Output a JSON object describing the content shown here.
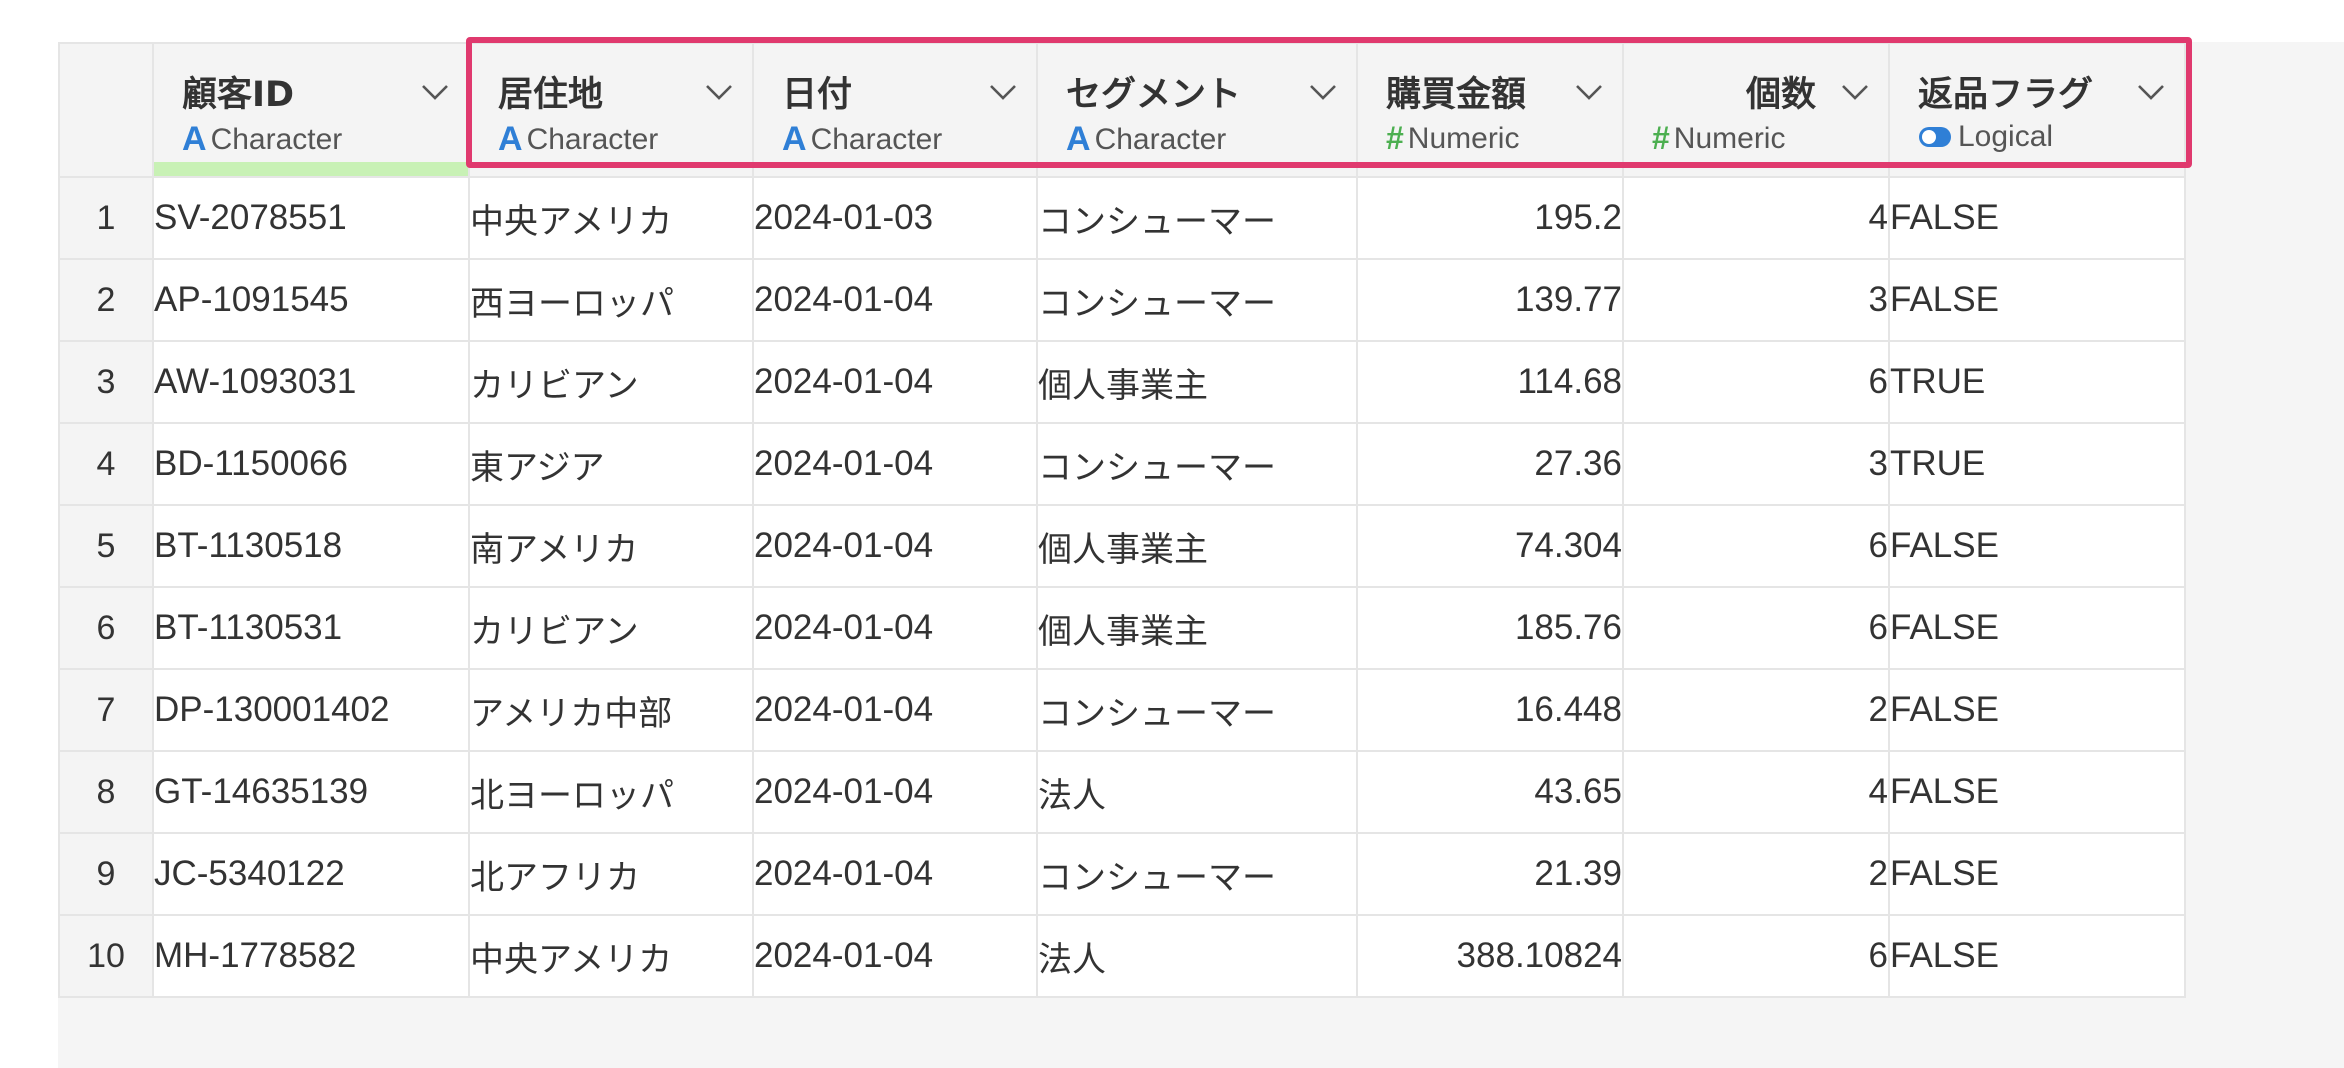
{
  "columns": [
    {
      "name": "顧客ID",
      "type": "Character",
      "type_icon": "character-icon"
    },
    {
      "name": "居住地",
      "type": "Character",
      "type_icon": "character-icon"
    },
    {
      "name": "日付",
      "type": "Character",
      "type_icon": "character-icon"
    },
    {
      "name": "セグメント",
      "type": "Character",
      "type_icon": "character-icon"
    },
    {
      "name": "購買金額",
      "type": "Numeric",
      "type_icon": "numeric-icon"
    },
    {
      "name": "個数",
      "type": "Numeric",
      "type_icon": "numeric-icon"
    },
    {
      "name": "返品フラグ",
      "type": "Logical",
      "type_icon": "logical-toggle-icon"
    }
  ],
  "rows": [
    {
      "n": "1",
      "id": "SV-2078551",
      "loc": "中央アメリカ",
      "date": "2024-01-03",
      "seg": "コンシューマー",
      "amt": "195.2",
      "qty": "4",
      "ret": "FALSE"
    },
    {
      "n": "2",
      "id": "AP-1091545",
      "loc": "西ヨーロッパ",
      "date": "2024-01-04",
      "seg": "コンシューマー",
      "amt": "139.77",
      "qty": "3",
      "ret": "FALSE"
    },
    {
      "n": "3",
      "id": "AW-1093031",
      "loc": "カリビアン",
      "date": "2024-01-04",
      "seg": "個人事業主",
      "amt": "114.68",
      "qty": "6",
      "ret": "TRUE"
    },
    {
      "n": "4",
      "id": "BD-1150066",
      "loc": "東アジア",
      "date": "2024-01-04",
      "seg": "コンシューマー",
      "amt": "27.36",
      "qty": "3",
      "ret": "TRUE"
    },
    {
      "n": "5",
      "id": "BT-1130518",
      "loc": "南アメリカ",
      "date": "2024-01-04",
      "seg": "個人事業主",
      "amt": "74.304",
      "qty": "6",
      "ret": "FALSE"
    },
    {
      "n": "6",
      "id": "BT-1130531",
      "loc": "カリビアン",
      "date": "2024-01-04",
      "seg": "個人事業主",
      "amt": "185.76",
      "qty": "6",
      "ret": "FALSE"
    },
    {
      "n": "7",
      "id": "DP-130001402",
      "loc": "アメリカ中部",
      "date": "2024-01-04",
      "seg": "コンシューマー",
      "amt": "16.448",
      "qty": "2",
      "ret": "FALSE"
    },
    {
      "n": "8",
      "id": "GT-14635139",
      "loc": "北ヨーロッパ",
      "date": "2024-01-04",
      "seg": "法人",
      "amt": "43.65",
      "qty": "4",
      "ret": "FALSE"
    },
    {
      "n": "9",
      "id": "JC-5340122",
      "loc": "北アフリカ",
      "date": "2024-01-04",
      "seg": "コンシューマー",
      "amt": "21.39",
      "qty": "2",
      "ret": "FALSE"
    },
    {
      "n": "10",
      "id": "MH-1778582",
      "loc": "中央アメリカ",
      "date": "2024-01-04",
      "seg": "法人",
      "amt": "388.10824",
      "qty": "6",
      "ret": "FALSE"
    }
  ],
  "colors": {
    "highlight": "#e0396e",
    "character_icon": "#2f7fd6",
    "numeric_icon": "#4caf50",
    "logical_icon": "#2f7fd6",
    "selected_column_bar": "#c8f1b5"
  }
}
